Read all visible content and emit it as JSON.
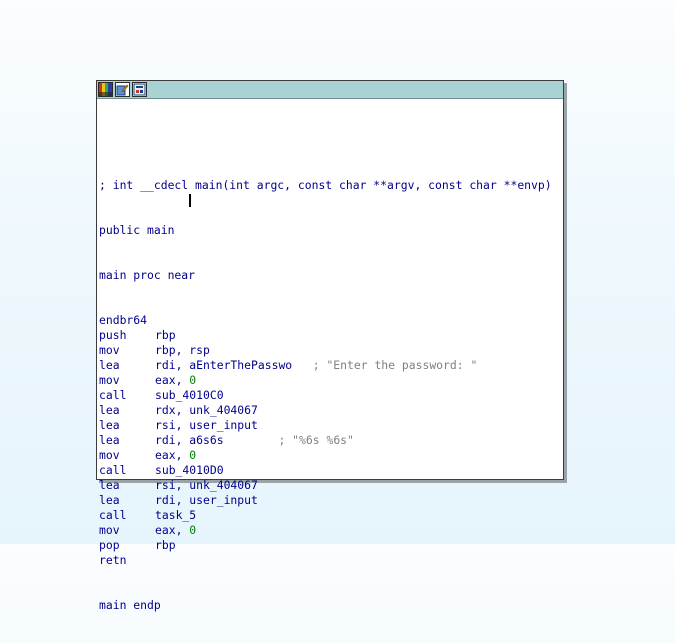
{
  "toolbar": {
    "buttons": [
      {
        "icon": "color-palette-icon"
      },
      {
        "icon": "edit-node-icon"
      },
      {
        "icon": "graph-overview-icon"
      }
    ]
  },
  "code": {
    "header_comment": "; int __cdecl main(int argc, const char **argv, const char **envp)",
    "public_line": "public main",
    "proc_line": "main proc near",
    "instructions": [
      {
        "mnemonic": "endbr64",
        "operands": "",
        "comment": ""
      },
      {
        "mnemonic": "push",
        "operands": "rbp",
        "comment": ""
      },
      {
        "mnemonic": "mov",
        "operands": "rbp, rsp",
        "comment": ""
      },
      {
        "mnemonic": "lea",
        "operands": "rdi, aEnterThePasswo",
        "comment": "; \"Enter the password: \""
      },
      {
        "mnemonic": "mov",
        "operands": "eax, ",
        "imm": "0",
        "comment": ""
      },
      {
        "mnemonic": "call",
        "operands": "sub_4010C0",
        "comment": ""
      },
      {
        "mnemonic": "lea",
        "operands": "rdx, unk_404067",
        "comment": ""
      },
      {
        "mnemonic": "lea",
        "operands": "rsi, user_input",
        "comment": ""
      },
      {
        "mnemonic": "lea",
        "operands": "rdi, a6s6s",
        "comment": "; \"%6s %6s\""
      },
      {
        "mnemonic": "mov",
        "operands": "eax, ",
        "imm": "0",
        "comment": ""
      },
      {
        "mnemonic": "call",
        "operands": "sub_4010D0",
        "comment": ""
      },
      {
        "mnemonic": "lea",
        "operands": "rsi, unk_404067",
        "comment": ""
      },
      {
        "mnemonic": "lea",
        "operands": "rdi, user_input",
        "comment": ""
      },
      {
        "mnemonic": "call",
        "operands": "task_5",
        "comment": ""
      },
      {
        "mnemonic": "mov",
        "operands": "eax, ",
        "imm": "0",
        "comment": ""
      },
      {
        "mnemonic": "pop",
        "operands": "rbp",
        "comment": ""
      },
      {
        "mnemonic": "retn",
        "operands": "",
        "comment": ""
      }
    ],
    "endp_line": "main endp"
  },
  "colors": {
    "code": "#00008b",
    "comment": "#808080",
    "number": "#008000",
    "titlebar": "#a9d2d4"
  }
}
